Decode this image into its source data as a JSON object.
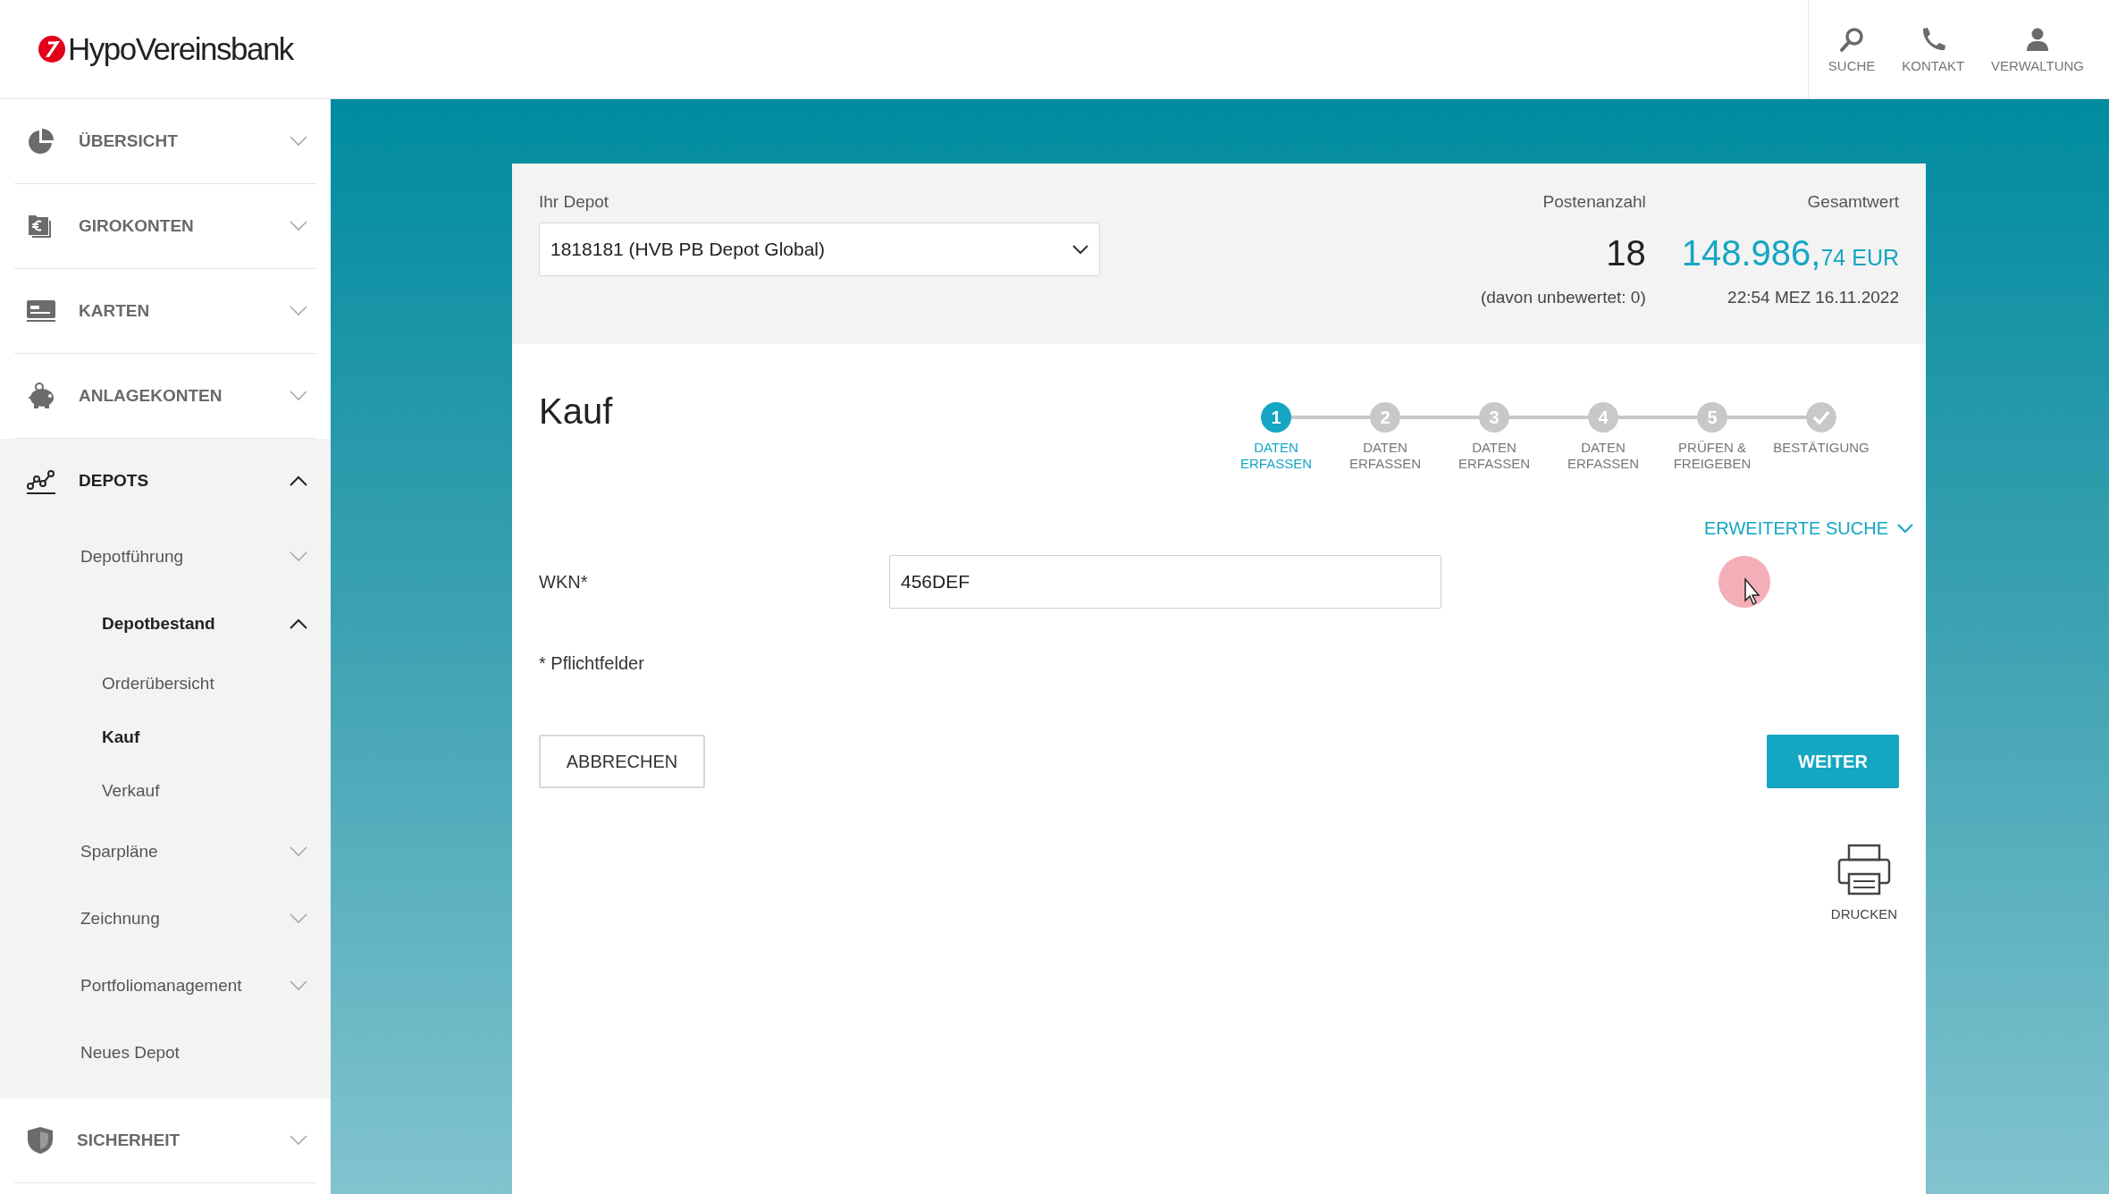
{
  "header": {
    "logo": "HypoVereinsbank",
    "actions": [
      {
        "label": "SUCHE"
      },
      {
        "label": "KONTAKT"
      },
      {
        "label": "VERWALTUNG"
      }
    ]
  },
  "sidebar": {
    "items": [
      {
        "label": "ÜBERSICHT",
        "expanded": false,
        "selected": false
      },
      {
        "label": "GIROKONTEN",
        "expanded": false,
        "selected": false
      },
      {
        "label": "KARTEN",
        "expanded": false,
        "selected": false
      },
      {
        "label": "ANLAGEKONTEN",
        "expanded": false,
        "selected": false
      },
      {
        "label": "DEPOTS",
        "expanded": true,
        "selected": true,
        "children": [
          {
            "label": "Depotführung",
            "expanded": false,
            "selected": false
          },
          {
            "label": "Depotbestand",
            "expanded": true,
            "selected": true,
            "children": [
              {
                "label": "Orderübersicht",
                "selected": false
              },
              {
                "label": "Kauf",
                "selected": true
              },
              {
                "label": "Verkauf",
                "selected": false
              }
            ]
          },
          {
            "label": "Sparpläne",
            "expanded": false,
            "selected": false
          },
          {
            "label": "Zeichnung",
            "expanded": false,
            "selected": false
          },
          {
            "label": "Portfoliomanagement",
            "expanded": false,
            "selected": false
          },
          {
            "label": "Neues Depot",
            "selected": false
          }
        ]
      },
      {
        "label": "SICHERHEIT",
        "expanded": false,
        "selected": false
      }
    ]
  },
  "depot": {
    "label": "Ihr Depot",
    "value": "1818181 (HVB PB Depot Global)",
    "count_label": "Postenanzahl",
    "count": "18",
    "count_note": "(davon unbewertet: 0)",
    "total_label": "Gesamtwert",
    "total_main": "148.986,",
    "total_fraction": "74 EUR",
    "timestamp": "22:54 MEZ 16.11.2022"
  },
  "form": {
    "title": "Kauf",
    "steps": [
      {
        "kind": "number",
        "number": "1",
        "label": "DATEN ERFASSEN",
        "selected": true
      },
      {
        "kind": "number",
        "number": "2",
        "label": "DATEN ERFASSEN",
        "selected": false
      },
      {
        "kind": "number",
        "number": "3",
        "label": "DATEN ERFASSEN",
        "selected": false
      },
      {
        "kind": "number",
        "number": "4",
        "label": "DATEN ERFASSEN",
        "selected": false
      },
      {
        "kind": "number",
        "number": "5",
        "label": "PRÜFEN & FREIGEBEN",
        "selected": false
      },
      {
        "kind": "check",
        "label": "BESTÄTIGUNG",
        "selected": false
      }
    ],
    "advanced_search": "ERWEITERTE SUCHE",
    "wkn_label": "WKN*",
    "wkn_value": "456DEF",
    "required_note": "* Pflichtfelder",
    "cancel": "ABBRECHEN",
    "next": "WEITER",
    "print": "DRUCKEN"
  }
}
